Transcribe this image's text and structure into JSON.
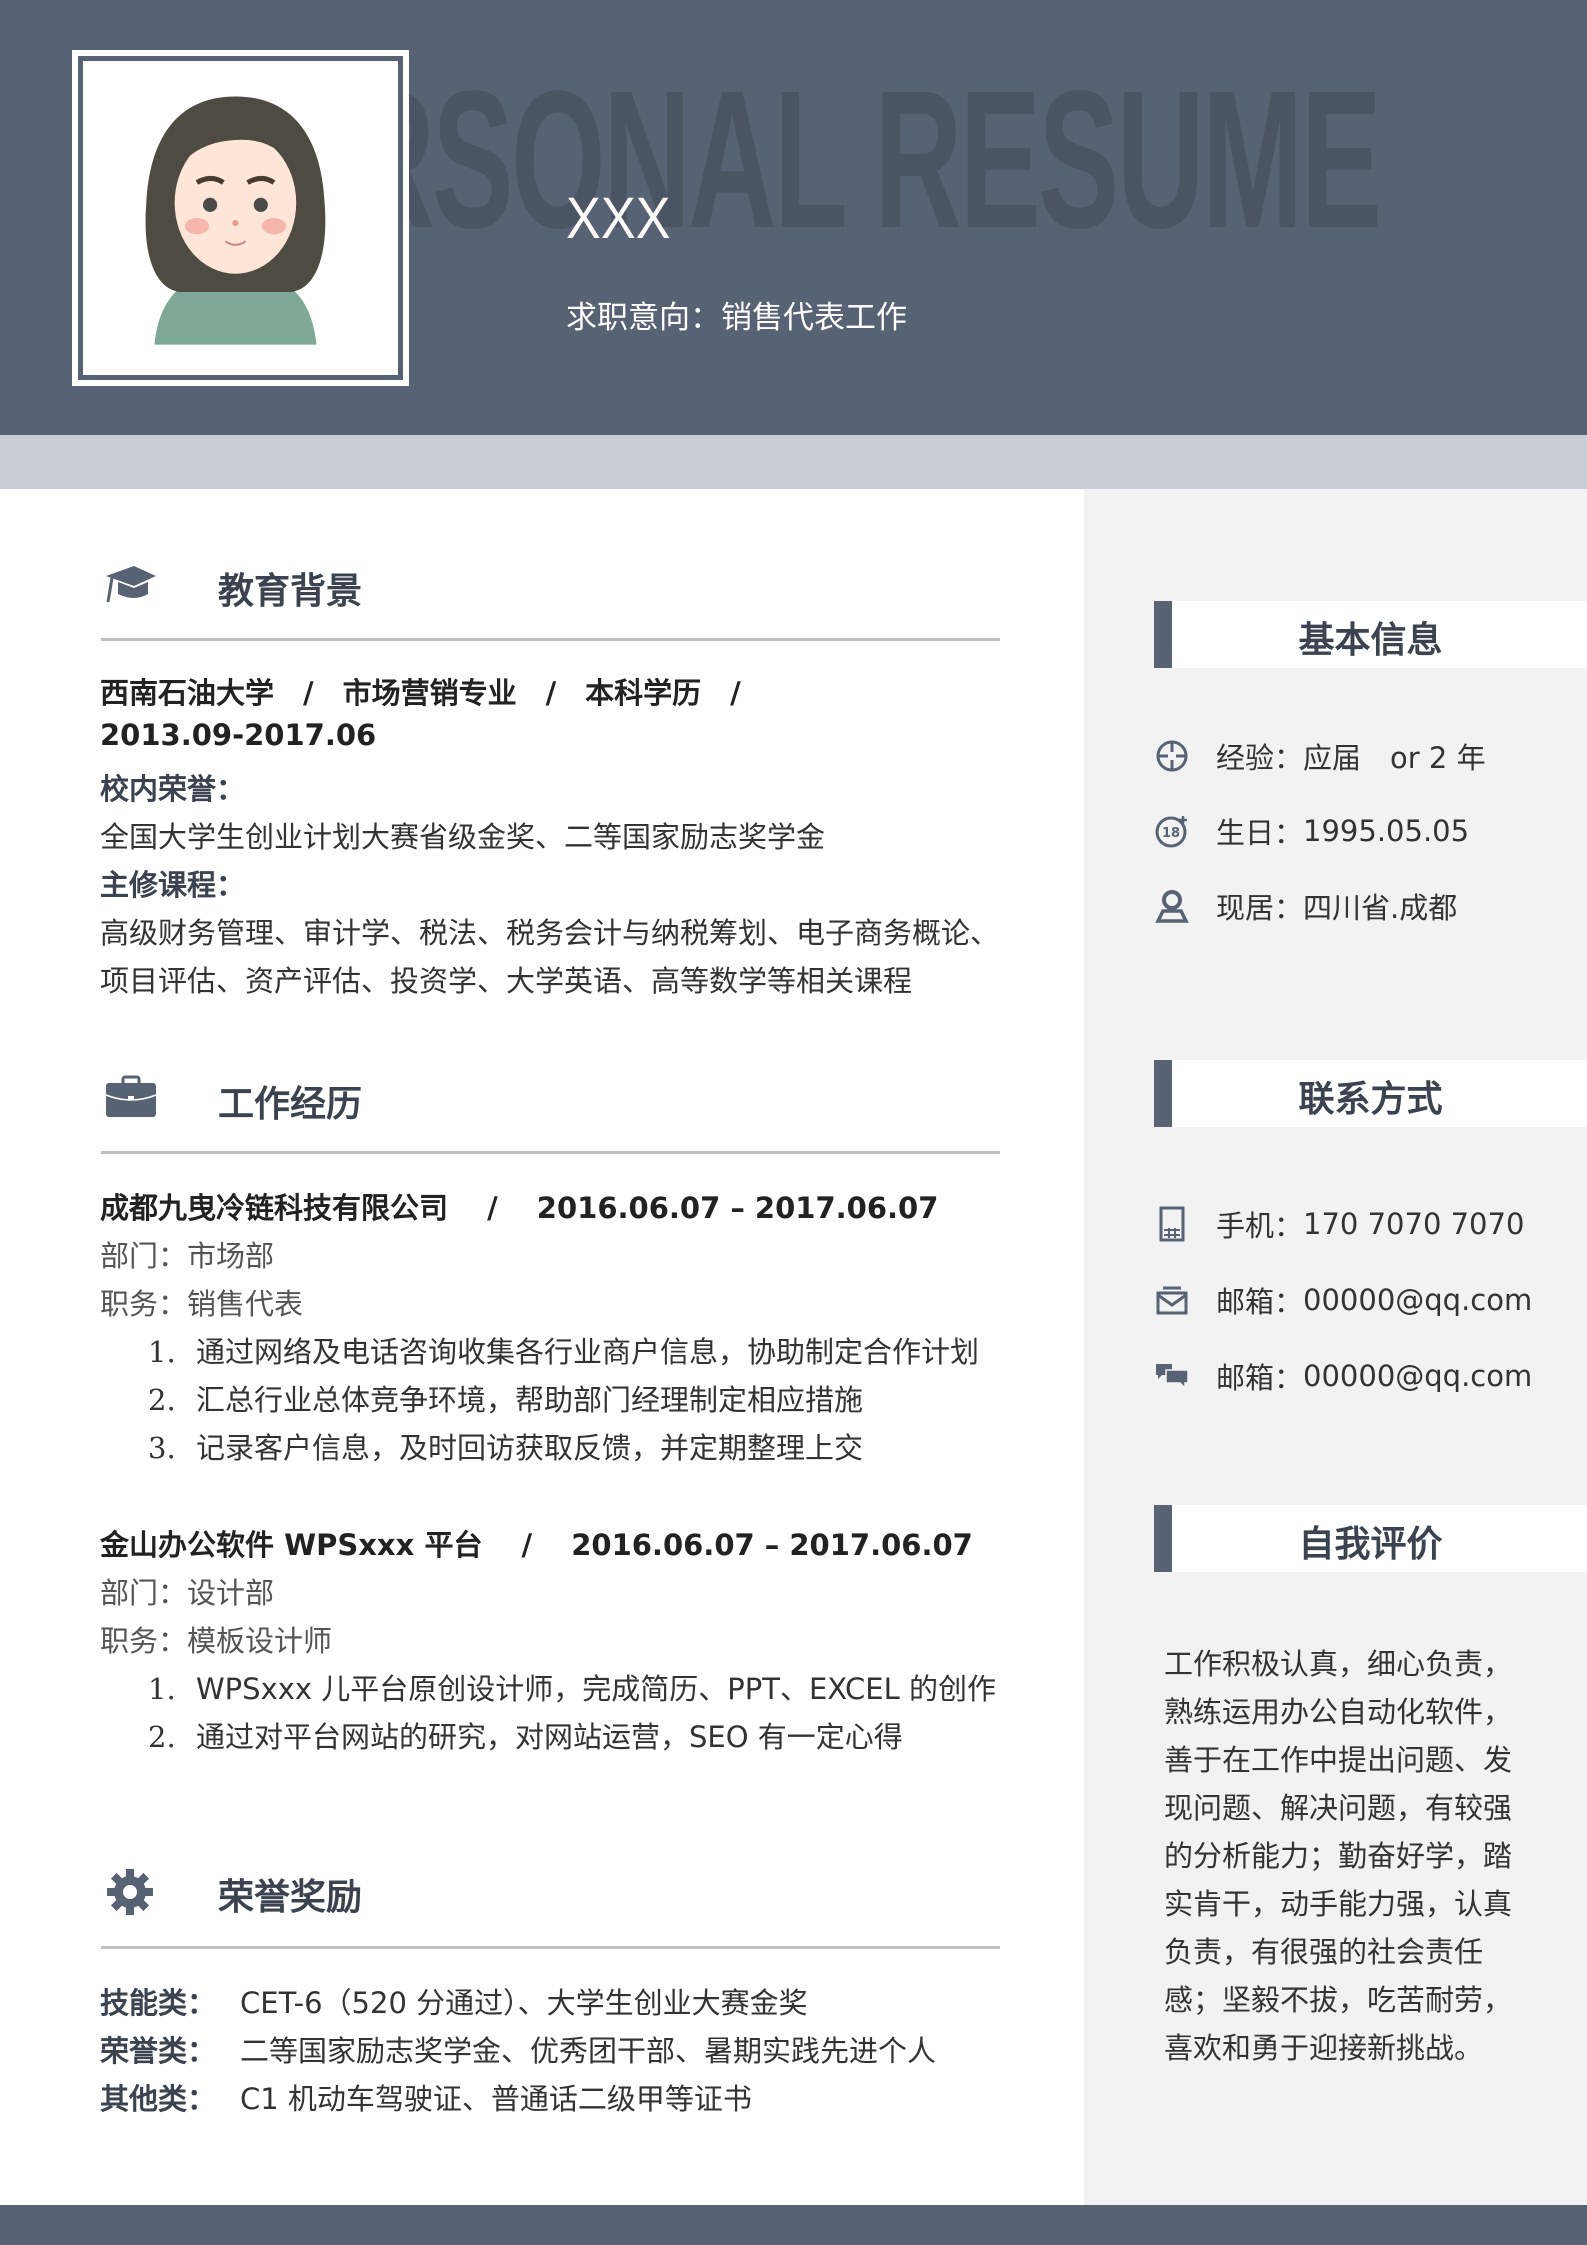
{
  "header": {
    "watermark": "PERSONAL RESUME",
    "name": "XXX",
    "job_intent": "求职意向：销售代表工作"
  },
  "colors": {
    "primary": "#576374",
    "band": "#c9cdd5",
    "sidebar": "#f2f2f2",
    "rule": "#c0c0c0"
  },
  "education": {
    "title": "教育背景",
    "icon": "graduation-cap-icon",
    "headline": "西南石油大学　/　市场营销专业　/　本科学历　/",
    "period": "2013.09-2017.06",
    "honors_label": "校内荣誉：",
    "honors": "全国大学生创业计划大赛省级金奖、二等国家励志奖学金",
    "courses_label": "主修课程：",
    "courses_1": "高级财务管理、审计学、税法、税务会计与纳税筹划、电子商务概论、",
    "courses_2": "项目评估、资产评估、投资学、大学英语、高等数学等相关课程"
  },
  "work": {
    "title": "工作经历",
    "icon": "briefcase-icon",
    "jobs": [
      {
        "headline": "成都九曳冷链科技有限公司　 /　 2016.06.07 – 2017.06.07",
        "dept": "部门：市场部",
        "role": "职务：销售代表",
        "items": [
          {
            "n": "1.",
            "t": "通过网络及电话咨询收集各行业商户信息，协助制定合作计划"
          },
          {
            "n": "2.",
            "t": "汇总行业总体竞争环境，帮助部门经理制定相应措施"
          },
          {
            "n": "3.",
            "t": "记录客户信息，及时回访获取反馈，并定期整理上交"
          }
        ]
      },
      {
        "headline": "金山办公软件 WPSxxx 平台　 /　 2016.06.07 – 2017.06.07",
        "dept": "部门：设计部",
        "role": "职务：模板设计师",
        "items": [
          {
            "n": "1.",
            "t": "WPSxxx 儿平台原创设计师，完成简历、PPT、EXCEL 的创作"
          },
          {
            "n": "2.",
            "t": "通过对平台网站的研究，对网站运营，SEO 有一定心得"
          }
        ]
      }
    ]
  },
  "awards": {
    "title": "荣誉奖励",
    "icon": "gear-icon",
    "rows": [
      {
        "label": "技能类：",
        "value": "CET-6（520 分通过）、大学生创业大赛金奖"
      },
      {
        "label": "荣誉类：",
        "value": "二等国家励志奖学金、优秀团干部、暑期实践先进个人"
      },
      {
        "label": "其他类：",
        "value": "C1 机动车驾驶证、普通话二级甲等证书"
      }
    ]
  },
  "basic_info": {
    "title": "基本信息",
    "rows": [
      {
        "icon": "crosshair-icon",
        "label": "经验：",
        "value": "应届　or 2 年"
      },
      {
        "icon": "age-18-icon",
        "label": "生日：",
        "value": "1995.05.05"
      },
      {
        "icon": "location-person-icon",
        "label": "现居：",
        "value": "四川省.成都"
      }
    ]
  },
  "contact": {
    "title": "联系方式",
    "rows": [
      {
        "icon": "phone-icon",
        "label": "手机：",
        "value": "170 7070 7070"
      },
      {
        "icon": "mail-icon",
        "label": "邮箱：",
        "value": "00000@qq.com"
      },
      {
        "icon": "chat-icon",
        "label": "邮箱：",
        "value": "00000@qq.com"
      }
    ]
  },
  "self_eval": {
    "title": "自我评价",
    "lines": [
      "工作积极认真，细心负责，",
      "熟练运用办公自动化软件，",
      "善于在工作中提出问题、发",
      "现问题、解决问题，有较强",
      "的分析能力；勤奋好学，踏",
      "实肯干，动手能力强，认真",
      "负责，有很强的社会责任",
      "感；坚毅不拔，吃苦耐劳，",
      "喜欢和勇于迎接新挑战。"
    ]
  }
}
